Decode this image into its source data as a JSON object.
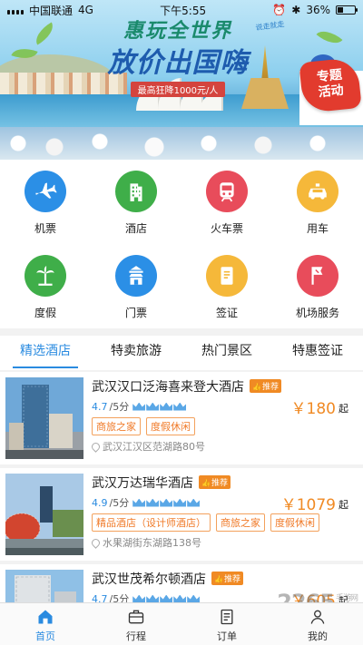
{
  "status_bar": {
    "carrier": "中国联通",
    "network": "4G",
    "time": "下午5:55",
    "battery": "36%",
    "battery_level": 0.36
  },
  "banner": {
    "headline_1": "惠玩全世界",
    "headline_2": "放价出国嗨",
    "subline": "最高狂降1000元/人",
    "stamp": "说走就走",
    "promo_badge": [
      "专题",
      "活动"
    ]
  },
  "services": [
    {
      "label": "机票",
      "icon": "airplane-icon",
      "color": "#2b8fe6"
    },
    {
      "label": "酒店",
      "icon": "hotel-building-icon",
      "color": "#3fae49"
    },
    {
      "label": "火车票",
      "icon": "train-icon",
      "color": "#e84c5b"
    },
    {
      "label": "用车",
      "icon": "car-icon",
      "color": "#f5b83a"
    },
    {
      "label": "度假",
      "icon": "palm-tree-icon",
      "color": "#3fae49"
    },
    {
      "label": "门票",
      "icon": "temple-icon",
      "color": "#2b8fe6"
    },
    {
      "label": "签证",
      "icon": "passport-icon",
      "color": "#f5b83a"
    },
    {
      "label": "机场服务",
      "icon": "airport-flag-icon",
      "color": "#e84c5b"
    }
  ],
  "tabs": [
    "精选酒店",
    "特卖旅游",
    "热门景区",
    "特惠签证"
  ],
  "hotels": [
    {
      "name": "武汉汉口泛海喜来登大酒店",
      "badge": "推荐",
      "score": "4.7",
      "score_unit": "/5分",
      "crowns": 4,
      "price": "￥180",
      "price_suffix": "起",
      "tags": [
        "商旅之家",
        "度假休闲"
      ],
      "address": "武汉江汉区范湖路80号"
    },
    {
      "name": "武汉万达瑞华酒店",
      "badge": "推荐",
      "score": "4.9",
      "score_unit": "/5分",
      "crowns": 5,
      "price": "￥1079",
      "price_suffix": "起",
      "tags": [
        "精品酒店（设计师酒店）",
        "商旅之家",
        "度假休闲"
      ],
      "address": "水果湖街东湖路138号"
    },
    {
      "name": "武汉世茂希尔顿酒店",
      "badge": "推荐",
      "score": "4.7",
      "score_unit": "/5分",
      "crowns": 5,
      "price": "￥605",
      "price_suffix": "起",
      "tags": [],
      "address": ""
    }
  ],
  "bottom_nav": [
    {
      "label": "首页",
      "icon": "home-icon",
      "active": true
    },
    {
      "label": "行程",
      "icon": "suitcase-icon",
      "active": false
    },
    {
      "label": "订单",
      "icon": "order-list-icon",
      "active": false
    },
    {
      "label": "我的",
      "icon": "user-icon",
      "active": false
    }
  ],
  "watermark": {
    "text": "2265",
    "sub": "手游网"
  }
}
